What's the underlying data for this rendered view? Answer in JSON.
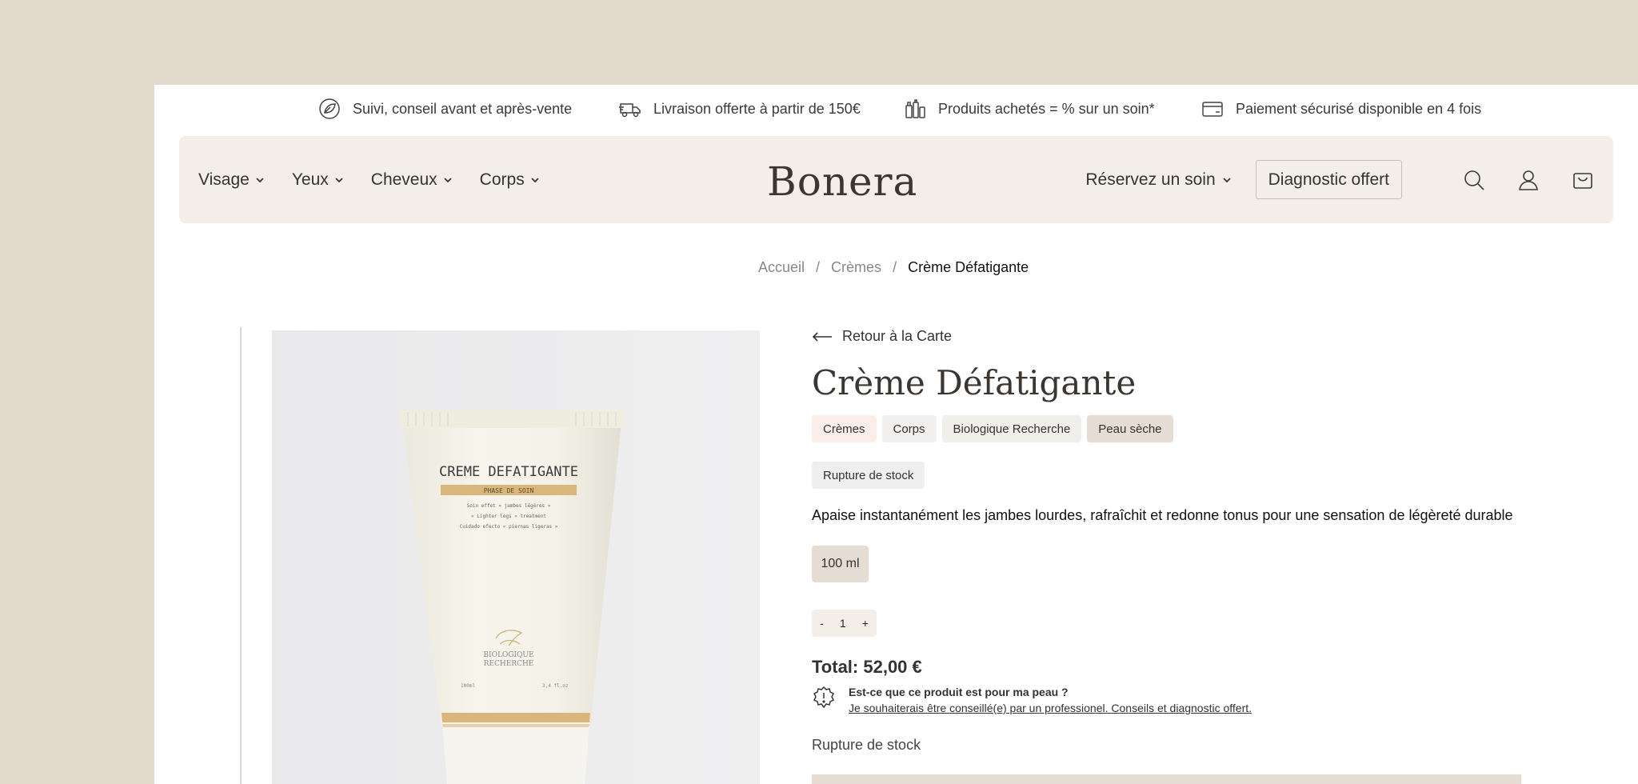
{
  "topbar": {
    "items": [
      {
        "icon": "support-leaf-icon",
        "label": "Suivi, conseil avant et après-vente"
      },
      {
        "icon": "delivery-truck-icon",
        "label": "Livraison offerte à partir de 150€"
      },
      {
        "icon": "products-icon",
        "label": "Produits achetés = % sur un soin*"
      },
      {
        "icon": "card-payment-icon",
        "label": "Paiement sécurisé disponible en 4 fois"
      }
    ]
  },
  "header": {
    "nav": [
      {
        "label": "Visage"
      },
      {
        "label": "Yeux"
      },
      {
        "label": "Cheveux"
      },
      {
        "label": "Corps"
      }
    ],
    "logo": "Bonera",
    "reserve_label": "Réservez un soin",
    "diagnostic_label": "Diagnostic offert",
    "icons": [
      "search-icon",
      "account-icon",
      "cart-icon"
    ]
  },
  "breadcrumb": {
    "items": [
      "Accueil",
      "Crèmes",
      "Crème Défatigante"
    ],
    "separator": "/"
  },
  "product": {
    "back_label": "Retour à la Carte",
    "title": "Crème Défatigante",
    "tags": [
      {
        "label": "Crèmes",
        "color": "#fbeeea"
      },
      {
        "label": "Corps",
        "color": "#f1f0ee"
      },
      {
        "label": "Biologique Recherche",
        "color": "#f1efec"
      },
      {
        "label": "Peau sèche",
        "color": "#e5dcd3"
      }
    ],
    "stock_badge": "Rupture de stock",
    "description": "Apaise instantanément les jambes lourdes, rafraîchit et redonne tonus pour une sensation de légèreté durable",
    "size": "100 ml",
    "quantity": {
      "minus": "-",
      "value": "1",
      "plus": "+"
    },
    "total": "Total: 52,00 €",
    "advice": {
      "question": "Est-ce que ce produit est pour ma peau ?",
      "link": "Je souhaiterais être conseillé(e) par un professionel. Conseils et diagnostic offert."
    },
    "stock_status": "Rupture de stock",
    "image": {
      "tube_title": "CREME DEFATIGANTE",
      "tube_band": "PHASE DE SOIN",
      "tube_lines": [
        "Soin effet « jambes légères »",
        "« Lighter legs » treatment",
        "Cuidado efecto « piernas ligeras »"
      ],
      "brand": [
        "BIOLOGIQUE",
        "RECHERCHE"
      ],
      "volume_left": "100ml",
      "volume_right": "3,4 fl.oz"
    }
  },
  "colors": {
    "background": "#e2dacc",
    "header_bg": "#f3efe8",
    "accent_beige": "#e5dcd3",
    "text_dark": "#3b3632"
  }
}
